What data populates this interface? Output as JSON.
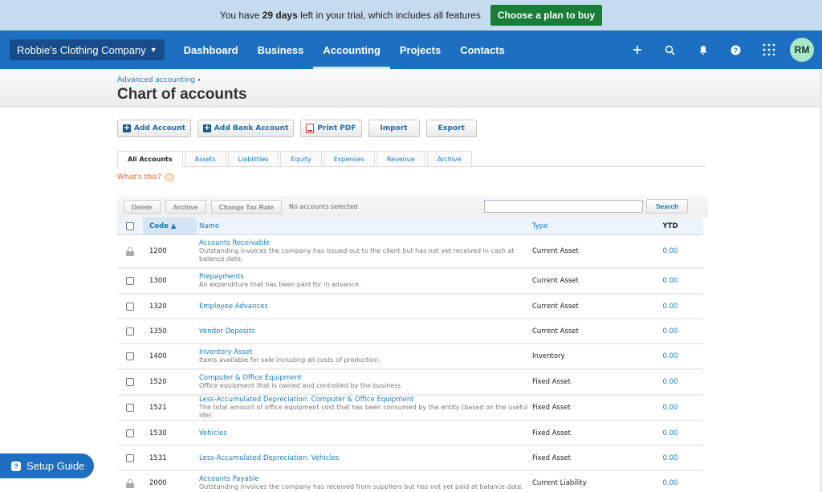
{
  "trial": {
    "text_before": "You have ",
    "days": "29 days",
    "text_after": " left in your trial, which includes all features",
    "cta": "Choose a plan to buy"
  },
  "nav": {
    "org": "Robbie's Clothing Company",
    "items": [
      {
        "label": "Dashboard",
        "active": false
      },
      {
        "label": "Business",
        "active": false
      },
      {
        "label": "Accounting",
        "active": true
      },
      {
        "label": "Projects",
        "active": false
      },
      {
        "label": "Contacts",
        "active": false
      }
    ],
    "icons": [
      "plus-icon",
      "search-icon",
      "bell-icon",
      "help-icon",
      "apps-grid-icon"
    ],
    "avatar_initials": "RM"
  },
  "page": {
    "breadcrumb": "Advanced accounting",
    "title": "Chart of accounts"
  },
  "toolbar": {
    "add_account": "Add Account",
    "add_bank_account": "Add Bank Account",
    "print_pdf": "Print PDF",
    "import": "Import",
    "export": "Export"
  },
  "tabs": [
    {
      "label": "All Accounts",
      "active": true
    },
    {
      "label": "Assets",
      "active": false
    },
    {
      "label": "Liabilities",
      "active": false
    },
    {
      "label": "Equity",
      "active": false
    },
    {
      "label": "Expenses",
      "active": false
    },
    {
      "label": "Revenue",
      "active": false
    },
    {
      "label": "Archive",
      "active": false
    }
  ],
  "whats_this": "What's this?",
  "actions": {
    "delete": "Delete",
    "archive": "Archive",
    "change_tax_rate": "Change Tax Rate",
    "selection_status": "No accounts selected",
    "search_value": "",
    "search_button": "Search"
  },
  "table": {
    "headers": {
      "code": "Code ▲",
      "name": "Name",
      "type": "Type",
      "ytd": "YTD"
    },
    "rows": [
      {
        "locked": true,
        "code": "1200",
        "name": "Accounts Receivable",
        "desc": "Outstanding invoices the company has issued out to the client but has not yet received in cash at balance date.",
        "type": "Current Asset",
        "ytd": "0.00"
      },
      {
        "locked": false,
        "code": "1300",
        "name": "Prepayments",
        "desc": "An expenditure that has been paid for in advance.",
        "type": "Current Asset",
        "ytd": "0.00"
      },
      {
        "locked": false,
        "code": "1320",
        "name": "Employee Advances",
        "desc": "",
        "type": "Current Asset",
        "ytd": "0.00"
      },
      {
        "locked": false,
        "code": "1350",
        "name": "Vendor Deposits",
        "desc": "",
        "type": "Current Asset",
        "ytd": "0.00"
      },
      {
        "locked": false,
        "code": "1400",
        "name": "Inventory Asset",
        "desc": "Items available for sale including all costs of production.",
        "type": "Inventory",
        "ytd": "0.00"
      },
      {
        "locked": false,
        "code": "1520",
        "name": "Computer & Office Equipment",
        "desc": "Office equipment that is owned and controlled by the business",
        "type": "Fixed Asset",
        "ytd": "0.00"
      },
      {
        "locked": false,
        "code": "1521",
        "name": "Less-Accumulated Depreciation: Computer & Office Equipment",
        "desc": "The total amount of office equipment cost that has been consumed by the entity (based on the useful life)",
        "type": "Fixed Asset",
        "ytd": "0.00"
      },
      {
        "locked": false,
        "code": "1530",
        "name": "Vehicles",
        "desc": "",
        "type": "Fixed Asset",
        "ytd": "0.00"
      },
      {
        "locked": false,
        "code": "1531",
        "name": "Less-Accumulated Depreciation: Vehicles",
        "desc": "",
        "type": "Fixed Asset",
        "ytd": "0.00"
      },
      {
        "locked": true,
        "code": "2000",
        "name": "Accounts Payable",
        "desc": "Outstanding invoices the company has received from suppliers but has not yet paid at balance date.",
        "type": "Current Liability",
        "ytd": "0.00"
      }
    ]
  },
  "setup_guide": "Setup Guide"
}
